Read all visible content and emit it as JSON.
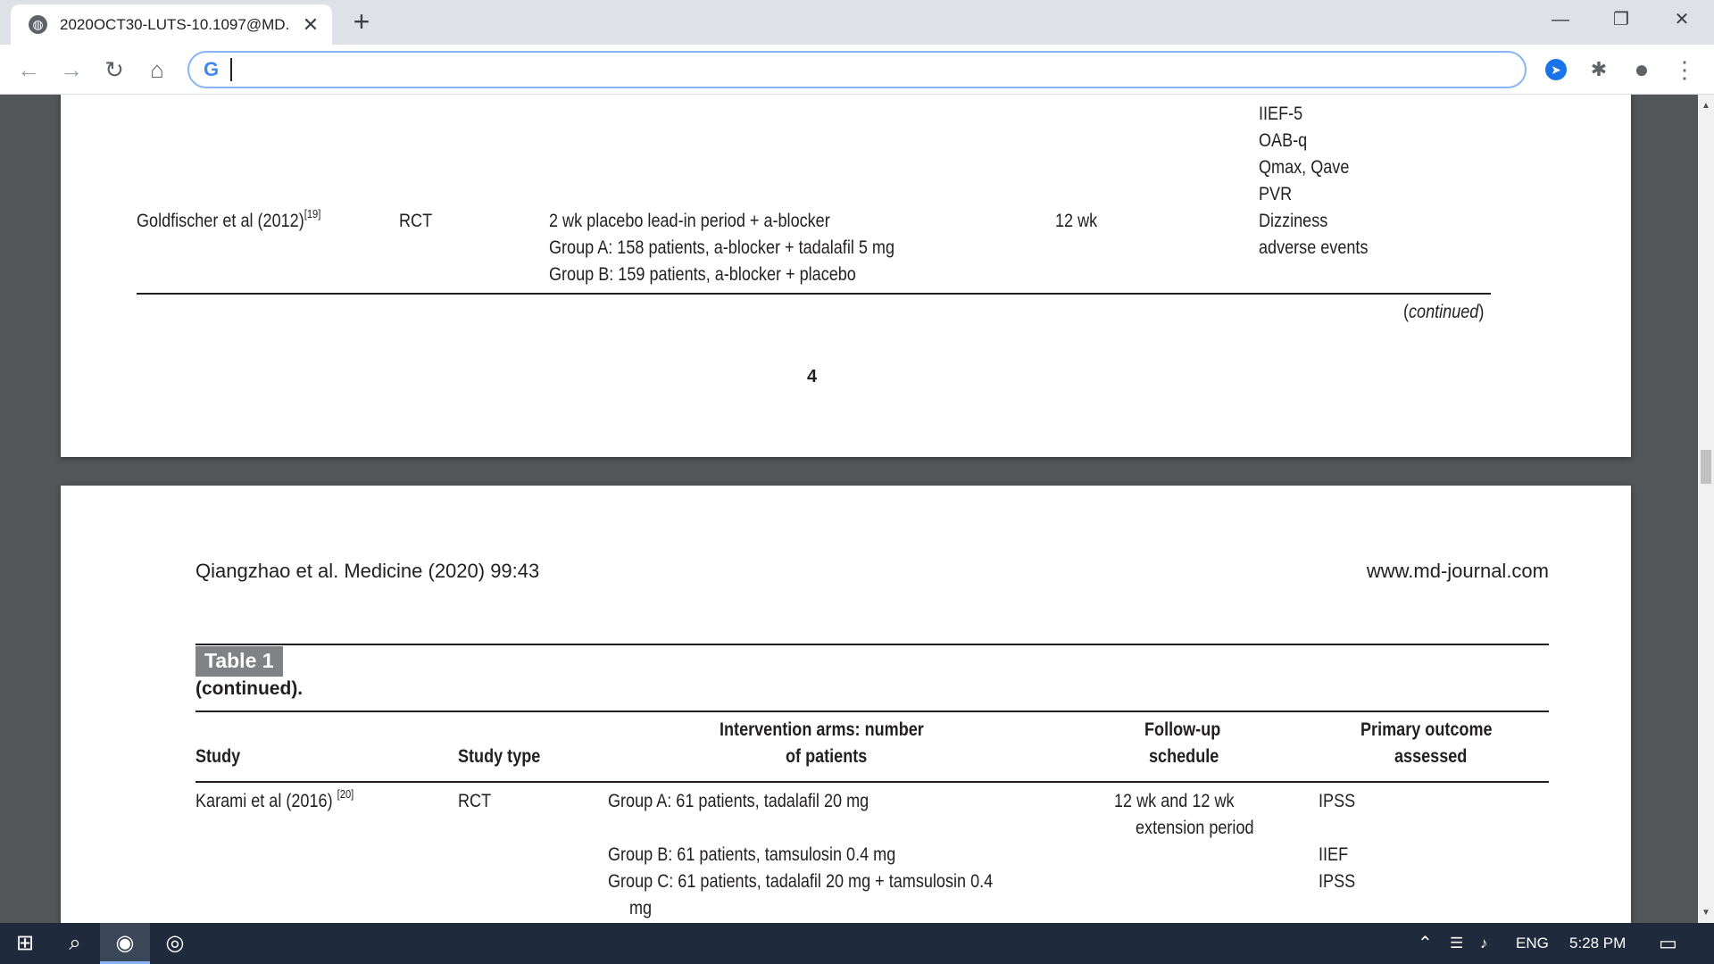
{
  "browser": {
    "tab_title": "2020OCT30-LUTS-10.1097@MD.",
    "tab_close": "✕",
    "new_tab": "+",
    "window_controls": {
      "minimize": "—",
      "restore": "❐",
      "close": "✕"
    },
    "nav": {
      "back": "←",
      "forward": "→",
      "reload": "↻",
      "home": "⌂"
    },
    "omnibox": {
      "value": "",
      "placeholder": ""
    },
    "omnibox_logo": "G",
    "menu": "⋮",
    "extensions": [
      "cursor-extension-icon",
      "puzzle-icon",
      "profile-icon"
    ]
  },
  "page1": {
    "row": {
      "study": "Goldfischer et al (2012)",
      "study_ref": "[19]",
      "type": "RCT",
      "arms": [
        "2 wk placebo lead-in period + a-blocker",
        "Group A: 158 patients, a-blocker + tadalafil 5 mg",
        "Group B: 159 patients, a-blocker + placebo"
      ],
      "followup": "12 wk",
      "outcomes": [
        "IIEF-5",
        "OAB-q",
        "Qmax, Qave",
        "PVR",
        "Dizziness",
        "adverse events"
      ]
    },
    "continued": "continued",
    "page_number": "4"
  },
  "page2": {
    "header_left": "Qiangzhao et al. Medicine (2020) 99:43",
    "header_right": "www.md-journal.com",
    "table_label": "Table 1",
    "table_caption": "(continued).",
    "columns": {
      "study": "Study",
      "type": "Study type",
      "arms_1": "Intervention arms: number",
      "arms_2": "of patients",
      "followup_1": "Follow-up",
      "followup_2": "schedule",
      "outcome_1": "Primary outcome",
      "outcome_2": "assessed"
    },
    "row": {
      "study": "Karami et al (2016)",
      "study_ref": "[20]",
      "type": "RCT",
      "arm_a": "Group A: 61 patients, tadalafil 20 mg",
      "arm_b": "Group B: 61 patients, tamsulosin 0.4 mg",
      "arm_c": "Group C: 61 patients, tadalafil 20 mg + tamsulosin 0.4",
      "arm_c_cont": "mg",
      "followup_1": "12 wk and 12 wk",
      "followup_2": "extension period",
      "outcome_a": "IPSS",
      "outcome_b": "IIEF",
      "outcome_c": "IPSS"
    }
  },
  "taskbar": {
    "language": "ENG",
    "time": "5:28 PM"
  }
}
